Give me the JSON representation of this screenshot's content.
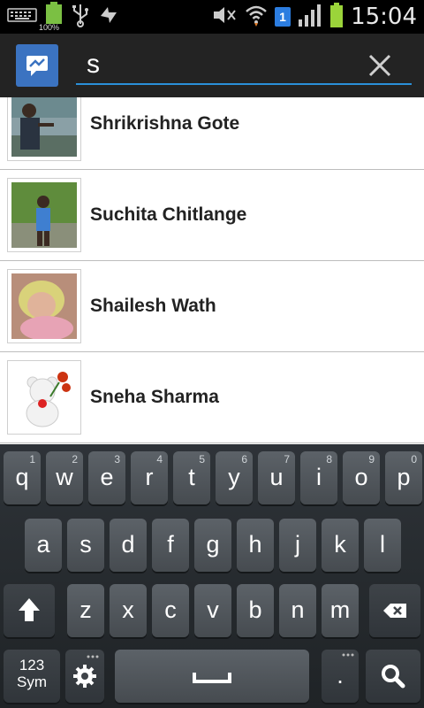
{
  "status_bar": {
    "time": "15:04",
    "battery_label": "100%",
    "sim_badge": "1",
    "icons": [
      "keyboard-icon",
      "battery-icon",
      "usb-icon",
      "sync-icon",
      "mute-icon",
      "wifi-icon",
      "sim-icon",
      "signal-icon",
      "battery-full-icon"
    ]
  },
  "action_bar": {
    "search_value": "s",
    "search_placeholder": "",
    "accent_color": "#2a8fd8",
    "app_icon_color": "#3b73c1"
  },
  "contacts": [
    {
      "name": "Shrikrishna Gote"
    },
    {
      "name": "Suchita Chitlange"
    },
    {
      "name": "Shailesh Wath"
    },
    {
      "name": "Sneha Sharma"
    }
  ],
  "keyboard": {
    "row1": [
      {
        "label": "q",
        "sub": "1"
      },
      {
        "label": "w",
        "sub": "2"
      },
      {
        "label": "e",
        "sub": "3"
      },
      {
        "label": "r",
        "sub": "4"
      },
      {
        "label": "t",
        "sub": "5"
      },
      {
        "label": "y",
        "sub": "6"
      },
      {
        "label": "u",
        "sub": "7"
      },
      {
        "label": "i",
        "sub": "8"
      },
      {
        "label": "o",
        "sub": "9"
      },
      {
        "label": "p",
        "sub": "0"
      }
    ],
    "row2": [
      {
        "label": "a"
      },
      {
        "label": "s"
      },
      {
        "label": "d"
      },
      {
        "label": "f"
      },
      {
        "label": "g"
      },
      {
        "label": "h"
      },
      {
        "label": "j"
      },
      {
        "label": "k"
      },
      {
        "label": "l"
      }
    ],
    "row3": [
      {
        "label": "z"
      },
      {
        "label": "x"
      },
      {
        "label": "c"
      },
      {
        "label": "v"
      },
      {
        "label": "b"
      },
      {
        "label": "n"
      },
      {
        "label": "m"
      }
    ],
    "mode_key": {
      "line1": "123",
      "line2": "Sym"
    },
    "period_key": "."
  }
}
